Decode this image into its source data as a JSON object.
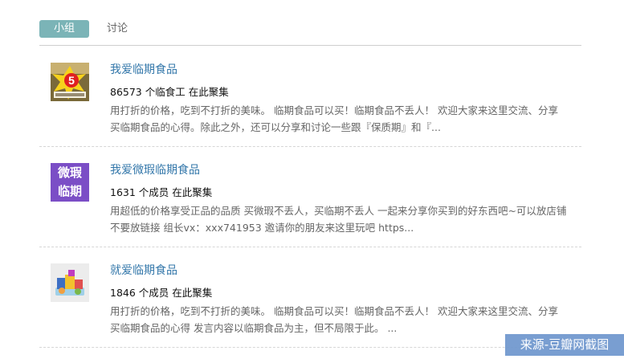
{
  "tabs": {
    "active": "小组",
    "other": "讨论"
  },
  "groups": [
    {
      "name": "我爱临期食品",
      "meta": "86573 个临食工 在此聚集",
      "desc_line1": "用打折的价格，吃到不打折的美味。 临期食品可以买！临期食品不丢人！ 欢迎大家来这里交流、分享",
      "desc_line2": "买临期食品的心得。除此之外，还可以分享和讨论一些跟『保质期』和『...",
      "thumb_text": "5"
    },
    {
      "name": "我爱微瑕临期食品",
      "meta": "1631 个成员 在此聚集",
      "desc_line1": "用超低的价格享受正品的品质 买微瑕不丢人，买临期不丢人 一起来分享你买到的好东西吧~可以放店铺",
      "desc_line2": "不要放链接 组长vx：xxx741953 邀请你的朋友来这里玩吧 https...",
      "thumb_line1": "微瑕",
      "thumb_line2": "临期"
    },
    {
      "name": "就爱临期食品",
      "meta": "1846 个成员 在此聚集",
      "desc_line1": "用打折的价格，吃到不打折的美味。 临期食品可以买！临期食品不丢人！ 欢迎大家来这里交流、分享",
      "desc_line2": "买临期食品的心得 发言内容以临期食品为主，但不局限于此。 ..."
    }
  ],
  "watermark": "来源-豆瓣网截图",
  "colors": {
    "tab_active_bg": "#7bb4b7",
    "link": "#3377aa",
    "purple_thumb": "#7b4ec6"
  }
}
